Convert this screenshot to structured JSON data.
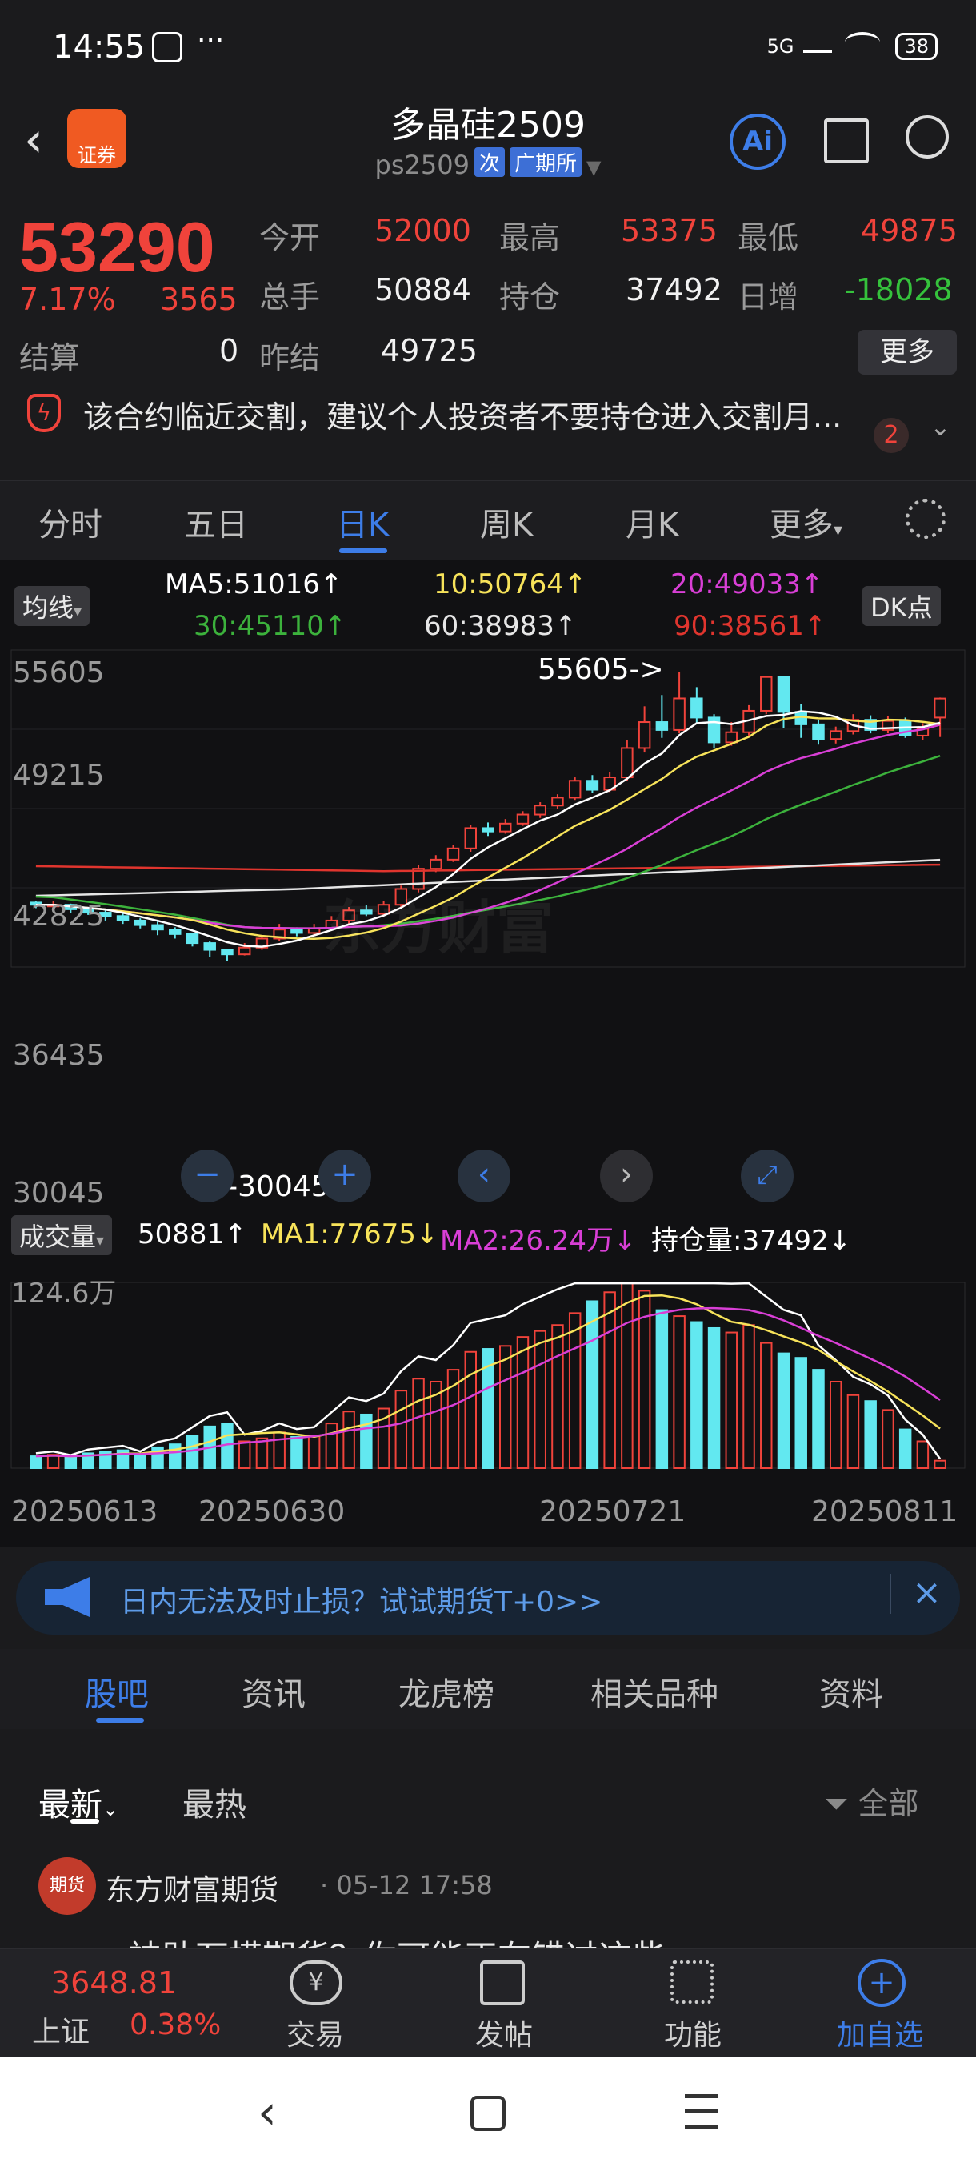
{
  "status_bar": {
    "time": "14:55",
    "more": "···",
    "network": "5G",
    "battery": "38"
  },
  "nav": {
    "title": "多晶硅2509",
    "code": "ps2509",
    "tag1": "次",
    "tag2": "广期所",
    "logo_text": "证券"
  },
  "quote": {
    "price": "53290",
    "change_pct": "7.17%",
    "change": "3565",
    "open_label": "今开",
    "open": "52000",
    "high_label": "最高",
    "high": "53375",
    "low_label": "最低",
    "low": "49875",
    "volume_label": "总手",
    "volume": "50884",
    "oi_label": "持仓",
    "oi": "37492",
    "daily_inc_label": "日增",
    "daily_inc": "-18028",
    "settle_label": "结算",
    "settle": "0",
    "prev_settle_label": "昨结",
    "prev_settle": "49725",
    "more_button": "更多"
  },
  "warning": {
    "text": "该合约临近交割，建议个人投资者不要持仓进入交割月...",
    "badge": "2"
  },
  "period_tabs": [
    "分时",
    "五日",
    "日K",
    "周K",
    "月K",
    "更多"
  ],
  "chart": {
    "ma_selector": "均线",
    "dk_button": "DK点",
    "ma5": "MA5:51016↑",
    "ma10": "10:50764↑",
    "ma20": "20:49033↑",
    "ma30": "30:45110↑",
    "ma60": "60:38983↑",
    "ma90": "90:38561↑",
    "high_marker": "55605->",
    "low_marker": "<-30045",
    "volume_selector": "成交量",
    "vol_value": "50881↑",
    "vol_ma1": "MA1:77675↓",
    "vol_ma2": "MA2:26.24万↓",
    "vol_oi": "持仓量:37492↓",
    "vol_max": "124.6万",
    "watermark": "东方财富",
    "colors": {
      "up": "#f0433b",
      "down": "#62e8f0",
      "ma5": "#ffffff",
      "ma10": "#f7e35a",
      "ma20": "#d93fd6",
      "ma30": "#3cb23c",
      "ma60": "#e6e6e6",
      "ma90": "#e0352e"
    }
  },
  "chart_data": {
    "type": "candlestick",
    "y_ticks": [
      "55605",
      "49215",
      "42825",
      "36435",
      "30045"
    ],
    "x_ticks": [
      "20250613",
      "20250630",
      "20250721",
      "20250811"
    ],
    "ylim": [
      30045,
      55605
    ],
    "candles": [
      [
        35200,
        35000,
        35300,
        34700
      ],
      [
        34900,
        35000,
        35300,
        34600
      ],
      [
        35000,
        34600,
        35100,
        34300
      ],
      [
        34600,
        34300,
        34800,
        34100
      ],
      [
        34300,
        34000,
        34600,
        33600
      ],
      [
        34000,
        33600,
        34200,
        33300
      ],
      [
        33600,
        33200,
        33800,
        32900
      ],
      [
        33200,
        32800,
        33500,
        32300
      ],
      [
        32800,
        32400,
        33000,
        32000
      ],
      [
        32400,
        31600,
        32500,
        31300
      ],
      [
        31600,
        31000,
        31800,
        30400
      ],
      [
        31000,
        30600,
        31100,
        30045
      ],
      [
        30600,
        31200,
        31600,
        30500
      ],
      [
        31200,
        32000,
        32300,
        31000
      ],
      [
        32000,
        32800,
        33300,
        31800
      ],
      [
        32800,
        32500,
        33000,
        32200
      ],
      [
        32500,
        32900,
        33300,
        32300
      ],
      [
        32900,
        33600,
        34000,
        32700
      ],
      [
        33600,
        34500,
        34800,
        33300
      ],
      [
        34500,
        34200,
        35000,
        34000
      ],
      [
        34200,
        35000,
        35300,
        34000
      ],
      [
        35000,
        36400,
        36700,
        34800
      ],
      [
        36400,
        38200,
        38500,
        36100
      ],
      [
        38200,
        39000,
        39400,
        37900
      ],
      [
        39000,
        40000,
        40300,
        38800
      ],
      [
        40000,
        41800,
        42100,
        39700
      ],
      [
        41800,
        41500,
        42300,
        41100
      ],
      [
        41500,
        42200,
        42600,
        41300
      ],
      [
        42200,
        43000,
        43300,
        42000
      ],
      [
        43000,
        43800,
        44100,
        42700
      ],
      [
        43800,
        44500,
        44800,
        43500
      ],
      [
        44500,
        46000,
        46300,
        44300
      ],
      [
        46000,
        45200,
        46500,
        44900
      ],
      [
        45200,
        46300,
        46800,
        45000
      ],
      [
        46300,
        48900,
        49600,
        46000
      ],
      [
        48900,
        51200,
        52600,
        48500
      ],
      [
        51200,
        50500,
        53600,
        49800
      ],
      [
        50500,
        53300,
        55605,
        50200
      ],
      [
        53300,
        51600,
        54300,
        51000
      ],
      [
        51600,
        49400,
        51900,
        48900
      ],
      [
        49400,
        50300,
        51200,
        49100
      ],
      [
        50300,
        52200,
        52700,
        50000
      ],
      [
        52200,
        55200,
        55300,
        51900
      ],
      [
        55200,
        52100,
        55300,
        50700
      ],
      [
        52100,
        51000,
        52800,
        49800
      ],
      [
        51000,
        49700,
        51400,
        49200
      ],
      [
        49700,
        50400,
        50800,
        49300
      ],
      [
        50400,
        51400,
        51900,
        50100
      ],
      [
        51400,
        50500,
        51800,
        50200
      ],
      [
        50500,
        51300,
        51700,
        50200
      ],
      [
        51300,
        50000,
        51600,
        49800
      ],
      [
        50000,
        50600,
        51100,
        49600
      ],
      [
        51600,
        53290,
        53375,
        49875
      ]
    ],
    "volume": [
      8,
      9,
      7,
      10,
      11,
      12,
      9,
      14,
      16,
      22,
      28,
      30,
      18,
      20,
      24,
      21,
      22,
      30,
      38,
      36,
      40,
      52,
      60,
      58,
      66,
      78,
      80,
      82,
      88,
      92,
      96,
      104,
      112,
      118,
      124.6,
      119,
      106,
      102,
      98,
      94,
      91,
      96,
      84,
      77,
      74,
      66,
      58,
      49,
      45,
      39,
      26,
      18,
      5
    ]
  },
  "banner": {
    "text": "日内无法及时止损？试试期货T+0>>"
  },
  "section_tabs": [
    "股吧",
    "资讯",
    "龙虎榜",
    "相关品种",
    "资料"
  ],
  "feed": {
    "sort_new": "最新",
    "sort_hot": "最热",
    "filter": "全部",
    "post_author": "东方财富期货",
    "post_time": "· 05-12 17:58",
    "avatar_text": "期货",
    "post_preview": "神助万模期货？你可能正在错过这些"
  },
  "bottom_bar": {
    "index_value": "3648.81",
    "index_name": "上证",
    "index_change": "0.38%",
    "trade": "交易",
    "post": "发帖",
    "func": "功能",
    "add": "加自选"
  }
}
